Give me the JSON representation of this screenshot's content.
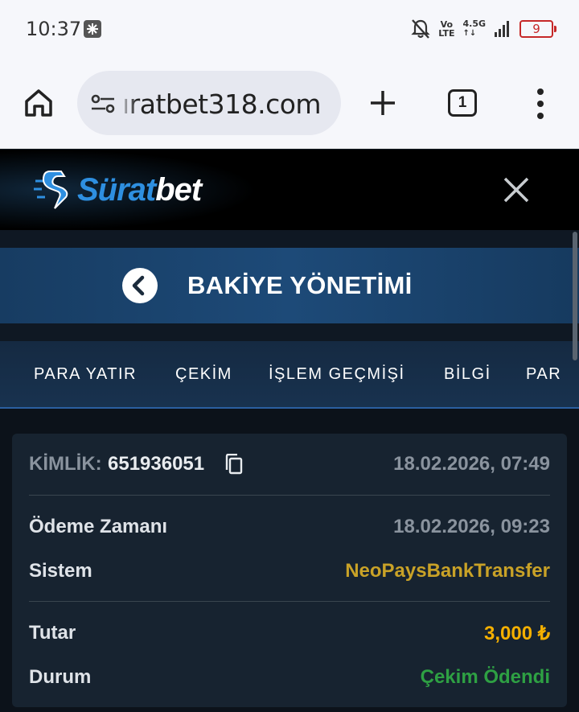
{
  "status_bar": {
    "time": "10:37",
    "network_volte_top": "Vo",
    "network_volte_bottom": "LTE",
    "network_type": "4.5G",
    "battery": "9",
    "icons": [
      "app-notification-icon",
      "bell-off-icon",
      "signal-icon",
      "battery-icon"
    ],
    "battery_color": "#c62828"
  },
  "browser": {
    "url": "ıratbet318.com",
    "tab_count": "1",
    "icons": [
      "home-icon",
      "site-settings-icon",
      "plus-icon",
      "tabs-icon",
      "more-vert-icon"
    ]
  },
  "site": {
    "logo_text_accent": "Sürat",
    "logo_text_main": "bet",
    "brand_color": "#2e8fe0",
    "icons": [
      "suratbet-logo-icon",
      "close-icon"
    ]
  },
  "page": {
    "title": "BAKİYE YÖNETİMİ",
    "icons": [
      "back-arrow-icon"
    ]
  },
  "tabs": [
    {
      "label": "PARA YATIR"
    },
    {
      "label": "ÇEKİM"
    },
    {
      "label": "İŞLEM GEÇMİŞİ"
    },
    {
      "label": "BİLGİ"
    },
    {
      "label": "PAR"
    }
  ],
  "transaction": {
    "id_label": "KİMLİK:",
    "id_value": "651936051",
    "created_at": "18.02.2026, 07:49",
    "payment_time_label": "Ödeme Zamanı",
    "payment_time_value": "18.02.2026, 09:23",
    "system_label": "Sistem",
    "system_value": "NeoPaysBankTransfer",
    "amount_label": "Tutar",
    "amount_value": "3,000 ₺",
    "status_label": "Durum",
    "status_value": "Çekim Ödendi",
    "colors": {
      "system": "#c9a227",
      "amount": "#f5b000",
      "status": "#2ea043"
    },
    "icons": [
      "copy-icon"
    ]
  }
}
